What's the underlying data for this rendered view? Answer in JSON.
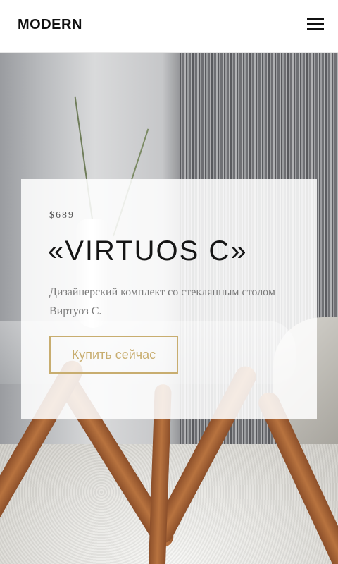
{
  "header": {
    "logo": "MODERN",
    "menu_icon": "hamburger-menu-icon"
  },
  "hero": {
    "price": "$689",
    "title": "«VIRTUOS C»",
    "description": "Дизайнерский комплект со стеклянным столом Виртуоз С.",
    "button_label": "Купить сейчас"
  },
  "colors": {
    "accent": "#c8ad6f",
    "title": "#151515",
    "text": "#7a7a7a"
  }
}
